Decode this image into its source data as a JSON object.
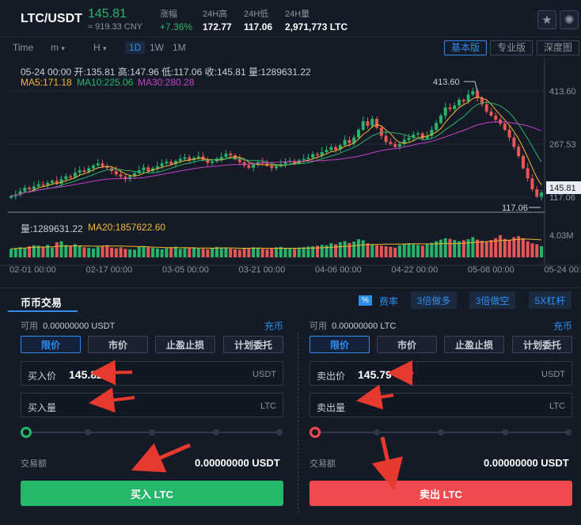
{
  "header": {
    "pair": "LTC/USDT",
    "price": "145.81",
    "cny": "≈ 919.33 CNY",
    "change_label": "涨幅",
    "change_value": "+7.36%",
    "high_label": "24H高",
    "high_value": "172.77",
    "low_label": "24H低",
    "low_value": "117.06",
    "vol_label": "24H量",
    "vol_value": "2,971,773 LTC",
    "star_icon": "star-icon",
    "settings_icon": "sun-icon"
  },
  "toolbar": {
    "time": "Time",
    "m": "m",
    "h": "H",
    "d1": "1D",
    "w1": "1W",
    "mo1": "1M",
    "basic": "基本版",
    "pro": "专业版",
    "depth": "深度图"
  },
  "chart_info": {
    "ohlc": "05-24 00:00  开:135.81  高:147.96  低:117.06  收:145.81  量:1289631.22",
    "ma5": "MA5:171.18",
    "ma10": "MA10:225.06",
    "ma30": "MA30:280.28",
    "vol": "量:1289631.22",
    "ma20": "MA20:1857622.60"
  },
  "chart_data": {
    "type": "candlestick",
    "x_ticks": [
      "02-01 00:00",
      "02-17 00:00",
      "03-05 00:00",
      "03-21 00:00",
      "04-06 00:00",
      "04-22 00:00",
      "05-08 00:00",
      "05-24 00:00"
    ],
    "y_ticks": [
      "413.60",
      "267.53",
      "117.06"
    ],
    "vol_ticks": [
      "4.03M"
    ],
    "high_marker": "413.60",
    "low_marker": "117.06",
    "last_price": "145.81",
    "ylim": [
      117,
      420
    ],
    "close": [
      137,
      141,
      149,
      158,
      154,
      161,
      166,
      164,
      170,
      175,
      168,
      179,
      186,
      184,
      195,
      201,
      197,
      206,
      213,
      218,
      211,
      206,
      199,
      191,
      185,
      179,
      186,
      194,
      201,
      208,
      199,
      206,
      211,
      218,
      222,
      216,
      224,
      229,
      233,
      226,
      231,
      235,
      226,
      219,
      223,
      230,
      234,
      242,
      238,
      228,
      221,
      213,
      207,
      215,
      221,
      218,
      212,
      206,
      211,
      216,
      221,
      224,
      218,
      226,
      229,
      232,
      241,
      238,
      246,
      251,
      258,
      252,
      263,
      276,
      268,
      282,
      301,
      322,
      311,
      328,
      306,
      286,
      271,
      266,
      259,
      266,
      276,
      281,
      289,
      292,
      279,
      286,
      301,
      318,
      336,
      356,
      352,
      361,
      375,
      371,
      388,
      396,
      379,
      364,
      346,
      336,
      326,
      316,
      301,
      282,
      259,
      236,
      206,
      181,
      154,
      136,
      146
    ],
    "volume": [
      42,
      45,
      50,
      47,
      55,
      60,
      58,
      52,
      62,
      48,
      75,
      80,
      61,
      55,
      65,
      58,
      50,
      47,
      44,
      52,
      56,
      60,
      48,
      45,
      50,
      42,
      40,
      38,
      52,
      55,
      50,
      47,
      44,
      40,
      46,
      50,
      53,
      42,
      45,
      48,
      50,
      44,
      42,
      40,
      47,
      52,
      49,
      45,
      43,
      40,
      38,
      44,
      46,
      50,
      48,
      42,
      40,
      45,
      50,
      52,
      47,
      44,
      42,
      48,
      50,
      53,
      55,
      58,
      62,
      60,
      70,
      65,
      75,
      80,
      72,
      78,
      90,
      85,
      70,
      65,
      60,
      58,
      55,
      52,
      48,
      60,
      65,
      70,
      68,
      62,
      58,
      66,
      72,
      80,
      88,
      95,
      92,
      86,
      80,
      85,
      90,
      100,
      88,
      82,
      78,
      86,
      95,
      110,
      92,
      85,
      100,
      105,
      95,
      80,
      70,
      65,
      55
    ]
  },
  "trade": {
    "tab": "币币交易",
    "fee_badge": "%",
    "fee_label": "费率",
    "long3": "3倍做多",
    "short3": "3倍做空",
    "lev5": "5X杠杆",
    "buy": {
      "avail_label": "可用",
      "avail_value": "0.00000000 USDT",
      "deposit": "充币",
      "types": [
        "限价",
        "市价",
        "止盈止损",
        "计划委托"
      ],
      "price_label": "买入价",
      "price_value": "145.82",
      "price_unit": "USDT",
      "amount_label": "买入量",
      "amount_unit": "LTC",
      "total_label": "交易额",
      "total_value": "0.00000000 USDT",
      "submit": "买入 LTC",
      "color": "#25b76a"
    },
    "sell": {
      "avail_label": "可用",
      "avail_value": "0.00000000 LTC",
      "deposit": "充币",
      "types": [
        "限价",
        "市价",
        "止盈止损",
        "计划委托"
      ],
      "price_label": "卖出价",
      "price_value": "145.79",
      "price_unit": "USDT",
      "amount_label": "卖出量",
      "amount_unit": "LTC",
      "total_label": "交易额",
      "total_value": "0.00000000 USDT",
      "submit": "卖出 LTC",
      "color": "#f04a4f"
    }
  },
  "colors": {
    "up": "#26b36b",
    "down": "#e85656",
    "ma5": "#f5b72f",
    "ma10": "#26b36b",
    "ma30": "#c640c6",
    "accent": "#2d8cf0",
    "annotation": "#e8392f"
  }
}
